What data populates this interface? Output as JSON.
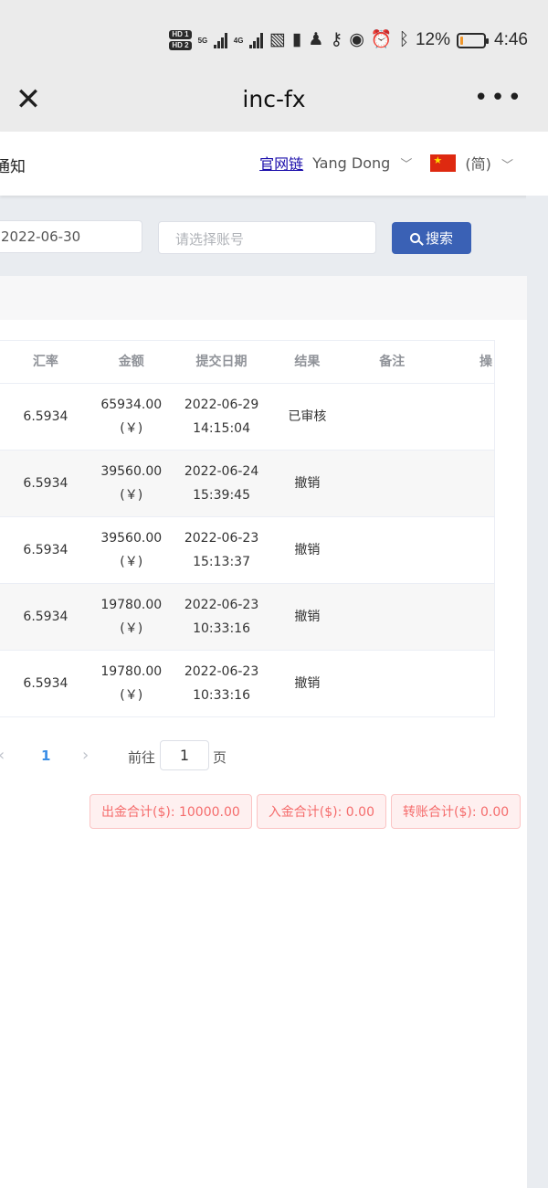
{
  "status_bar": {
    "hd1": "HD 1",
    "hd2": "HD 2",
    "net1": "5G",
    "net2": "4G",
    "battery_pct": "12%",
    "battery_level": 0.12,
    "battery_color": "#f0962a",
    "time": "4:46",
    "icons": [
      "hd-icon",
      "signal-5g-icon",
      "signal-4g-icon",
      "data-icon",
      "battery-saver-icon",
      "qq-icon",
      "key-icon",
      "eye-icon",
      "alarm-icon",
      "bluetooth-icon",
      "battery-icon"
    ]
  },
  "nav": {
    "title": "inc-fx",
    "close_glyph": "✕",
    "more_glyph": "•••"
  },
  "header": {
    "notice": "通知",
    "site_link": "官网链",
    "user_name": "Yang Dong",
    "language": "(简)",
    "flag": "cn-flag-icon"
  },
  "filters": {
    "date_value": "2022-06-30",
    "account_placeholder": "请选择账号",
    "search_label": "搜索"
  },
  "table": {
    "headers": [
      "汇率",
      "金额",
      "提交日期",
      "结果",
      "备注",
      "操"
    ],
    "rows": [
      {
        "rate": "6.5934",
        "amount": "65934.00",
        "currency": "(￥)",
        "date": "2022-06-29",
        "time": "14:15:04",
        "result": "已审核",
        "note": ""
      },
      {
        "rate": "6.5934",
        "amount": "39560.00",
        "currency": "(￥)",
        "date": "2022-06-24",
        "time": "15:39:45",
        "result": "撤销",
        "note": ""
      },
      {
        "rate": "6.5934",
        "amount": "39560.00",
        "currency": "(￥)",
        "date": "2022-06-23",
        "time": "15:13:37",
        "result": "撤销",
        "note": ""
      },
      {
        "rate": "6.5934",
        "amount": "19780.00",
        "currency": "(￥)",
        "date": "2022-06-23",
        "time": "10:33:16",
        "result": "撤销",
        "note": ""
      },
      {
        "rate": "6.5934",
        "amount": "19780.00",
        "currency": "(￥)",
        "date": "2022-06-23",
        "time": "10:33:16",
        "result": "撤销",
        "note": ""
      }
    ]
  },
  "pagination": {
    "prev": "‹",
    "current_page": "1",
    "next": "›",
    "goto_label": "前往",
    "goto_value": "1",
    "page_suffix": "页"
  },
  "totals": {
    "withdraw": "出金合计($): 10000.00",
    "deposit": "入金合计($): 0.00",
    "transfer": "转账合计($): 0.00"
  },
  "colors": {
    "primary_button": "#3a61b5",
    "active_page": "#3a8ee6",
    "total_tag_text": "#f56c6c",
    "total_tag_bg": "#fef0f0"
  }
}
